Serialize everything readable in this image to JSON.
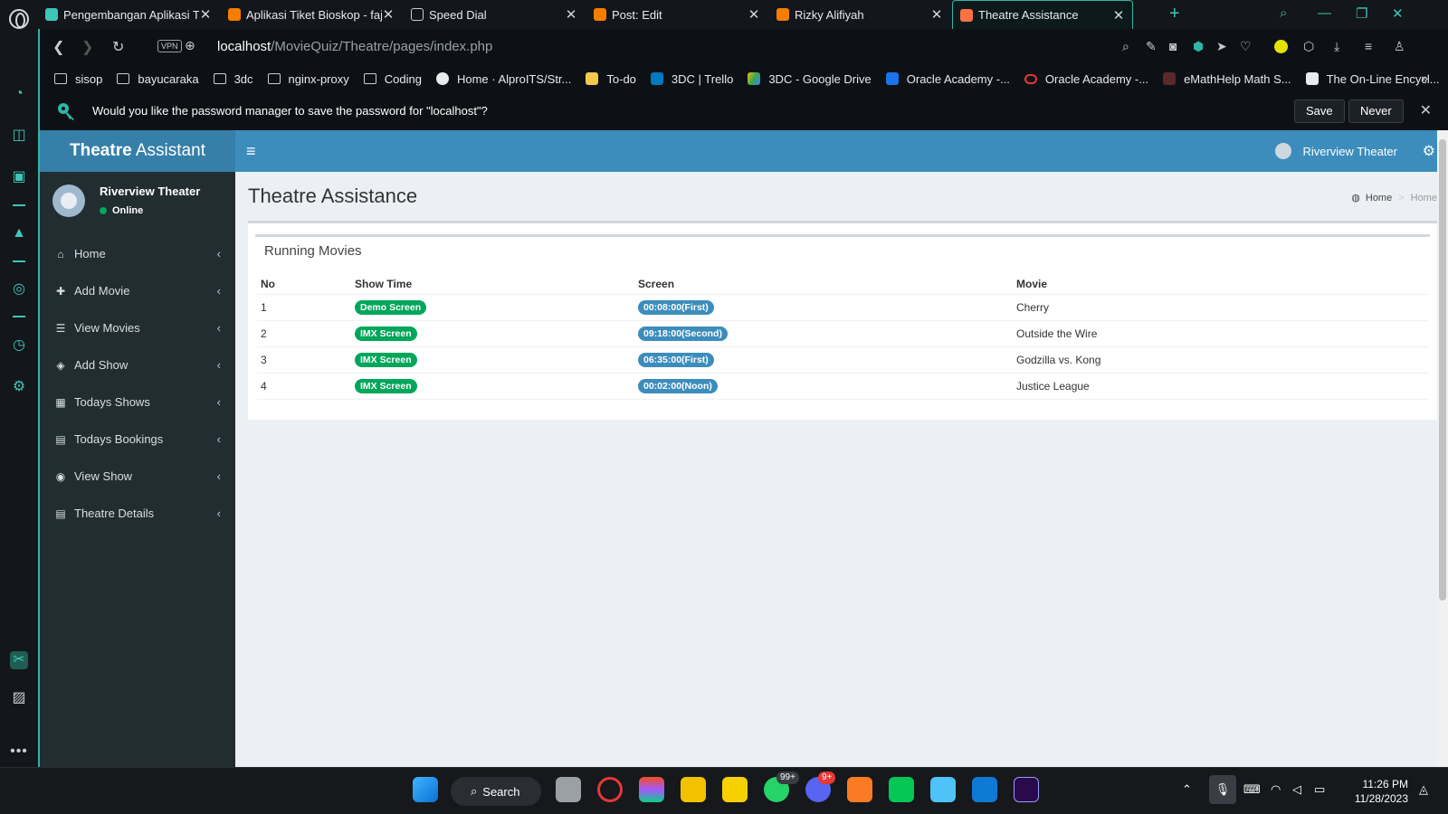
{
  "browser": {
    "tabs": [
      {
        "title": "Pengembangan Aplikasi Ti",
        "color": "#3ec6b8"
      },
      {
        "title": "Aplikasi Tiket Bioskop - faja",
        "color": "#f57d00"
      },
      {
        "title": "Speed Dial",
        "color": "#c9ccd1"
      },
      {
        "title": "Post: Edit",
        "color": "#f57d00"
      },
      {
        "title": "Rizky Alifiyah",
        "color": "#f57d00"
      },
      {
        "title": "Theatre Assistance",
        "color": "#ff7043"
      }
    ],
    "vpn_label": "VPN",
    "url_host": "localhost",
    "url_path": "/MovieQuiz/Theatre/pages/index.php",
    "bookmarks": [
      {
        "label": "sisop",
        "icon": "folder-icon"
      },
      {
        "label": "bayucaraka",
        "icon": "folder-icon"
      },
      {
        "label": "3dc",
        "icon": "folder-icon"
      },
      {
        "label": "nginx-proxy",
        "icon": "folder-icon"
      },
      {
        "label": "Coding",
        "icon": "folder-icon"
      },
      {
        "label": "Home · AlproITS/Str...",
        "icon": "github-icon"
      },
      {
        "label": "To-do",
        "icon": "todo-icon"
      },
      {
        "label": "3DC | Trello",
        "icon": "trello-icon"
      },
      {
        "label": "3DC - Google Drive",
        "icon": "drive-icon"
      },
      {
        "label": "Oracle Academy -...",
        "icon": "oracle-academy-icon"
      },
      {
        "label": "Oracle Academy -...",
        "icon": "oracle-icon"
      },
      {
        "label": "eMathHelp Math S...",
        "icon": "emathhelp-icon"
      },
      {
        "label": "The On-Line Encycl...",
        "icon": "oeis-icon"
      }
    ],
    "infobar": {
      "text": "Would you like the password manager to save the password for \"localhost\"?",
      "save": "Save",
      "never": "Never"
    },
    "accent": "#2fb5a5"
  },
  "app": {
    "logo_bold": "Theatre",
    "logo_rest": " Assistant",
    "navbar_user": "Riverview Theater",
    "sidebar": {
      "user_name": "Riverview Theater",
      "status": "Online",
      "items": [
        {
          "label": "Home",
          "icon": "home-icon",
          "glyph": "⌂"
        },
        {
          "label": "Add Movie",
          "icon": "plus-icon",
          "glyph": "✚"
        },
        {
          "label": "View Movies",
          "icon": "list-icon",
          "glyph": "☰"
        },
        {
          "label": "Add Show",
          "icon": "tag-icon",
          "glyph": "◈"
        },
        {
          "label": "Todays Shows",
          "icon": "calendar-icon",
          "glyph": "▦"
        },
        {
          "label": "Todays Bookings",
          "icon": "film-icon",
          "glyph": "▤"
        },
        {
          "label": "View Show",
          "icon": "eye-icon",
          "glyph": "◉"
        },
        {
          "label": "Theatre Details",
          "icon": "film-icon",
          "glyph": "▤"
        }
      ]
    },
    "page_title": "Theatre Assistance",
    "breadcrumb": [
      "Home",
      "Home"
    ],
    "box": {
      "title": "Running Movies",
      "columns": [
        "No",
        "Show Time",
        "Screen",
        "Movie"
      ],
      "rows": [
        {
          "no": "1",
          "show_time": "Demo Screen",
          "screen": "00:08:00(First)",
          "movie": "Cherry"
        },
        {
          "no": "2",
          "show_time": "IMX Screen",
          "screen": "09:18:00(Second)",
          "movie": "Outside the Wire"
        },
        {
          "no": "3",
          "show_time": "IMX Screen",
          "screen": "06:35:00(First)",
          "movie": "Godzilla vs. Kong"
        },
        {
          "no": "4",
          "show_time": "IMX Screen",
          "screen": "00:02:00(Noon)",
          "movie": "Justice League"
        }
      ]
    },
    "colors": {
      "navbar": "#3c8dbc",
      "logo_bg": "#367fa9",
      "sidebar_bg": "#222d32",
      "label_green": "#00a65a",
      "label_blue": "#3c8dbc"
    }
  },
  "taskbar": {
    "search_label": "Search",
    "whatsapp_badge": "99+",
    "discord_badge": "9+",
    "time": "11:26 PM",
    "date": "11/28/2023"
  }
}
